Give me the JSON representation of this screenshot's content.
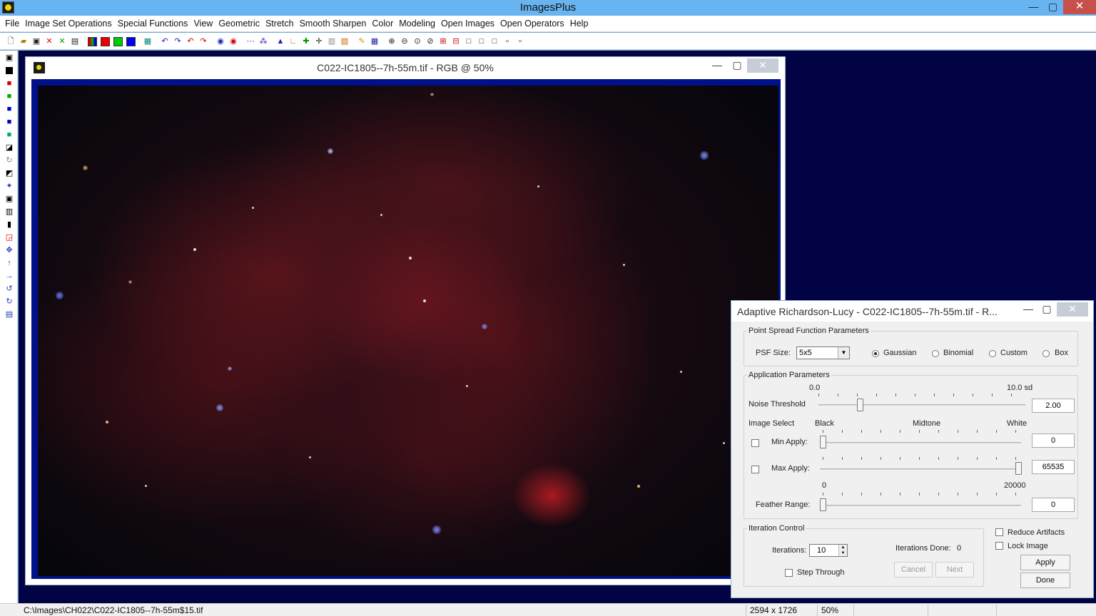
{
  "app": {
    "title": "ImagesPlus"
  },
  "window_controls": {
    "minimize": "—",
    "maximize": "▢",
    "close": "✕"
  },
  "menu": [
    "File",
    "Image Set Operations",
    "Special Functions",
    "View",
    "Geometric",
    "Stretch",
    "Smooth Sharpen",
    "Color",
    "Modeling",
    "Open Images",
    "Open Operators",
    "Help"
  ],
  "image_window": {
    "title": "C022-IC1805--7h-55m.tif - RGB @ 50%"
  },
  "dialog": {
    "title": "Adaptive Richardson-Lucy - C022-IC1805--7h-55m.tif - R...",
    "psf": {
      "legend": "Point Spread Function Parameters",
      "size_label": "PSF Size:",
      "size_value": "5x5",
      "shapes": [
        "Gaussian",
        "Binomial",
        "Custom",
        "Box"
      ],
      "selected": "Gaussian"
    },
    "application": {
      "legend": "Application Parameters",
      "noise_min": "0.0",
      "noise_max": "10.0 sd",
      "noise_label": "Noise Threshold",
      "noise_value": "2.00",
      "noise_level": 0.2,
      "image_select_label": "Image Select",
      "black": "Black",
      "midtone": "Midtone",
      "white": "White",
      "min_apply_label": "Min Apply:",
      "min_apply_value": "0",
      "max_apply_label": "Max Apply:",
      "max_apply_value": "65535",
      "feather_min": "0",
      "feather_max": "20000",
      "feather_label": "Feather Range:",
      "feather_value": "0"
    },
    "iteration": {
      "legend": "Iteration Control",
      "iterations_label": "Iterations:",
      "iterations_value": "10",
      "done_label": "Iterations Done:",
      "done_value": "0",
      "step_through": "Step Through",
      "cancel": "Cancel",
      "next": "Next"
    },
    "reduce_artifacts": "Reduce Artifacts",
    "lock_image": "Lock Image",
    "apply": "Apply",
    "done": "Done"
  },
  "status": {
    "path": "C:\\Images\\CH022\\C022-IC1805--7h-55m$15.tif",
    "dimensions": "2594 x 1726",
    "zoom": "50%"
  },
  "colors": {
    "titlebar": "#68b4f0",
    "mdi_background": "#020344",
    "image_frame": "#00108a",
    "close_button": "#c7504b"
  }
}
